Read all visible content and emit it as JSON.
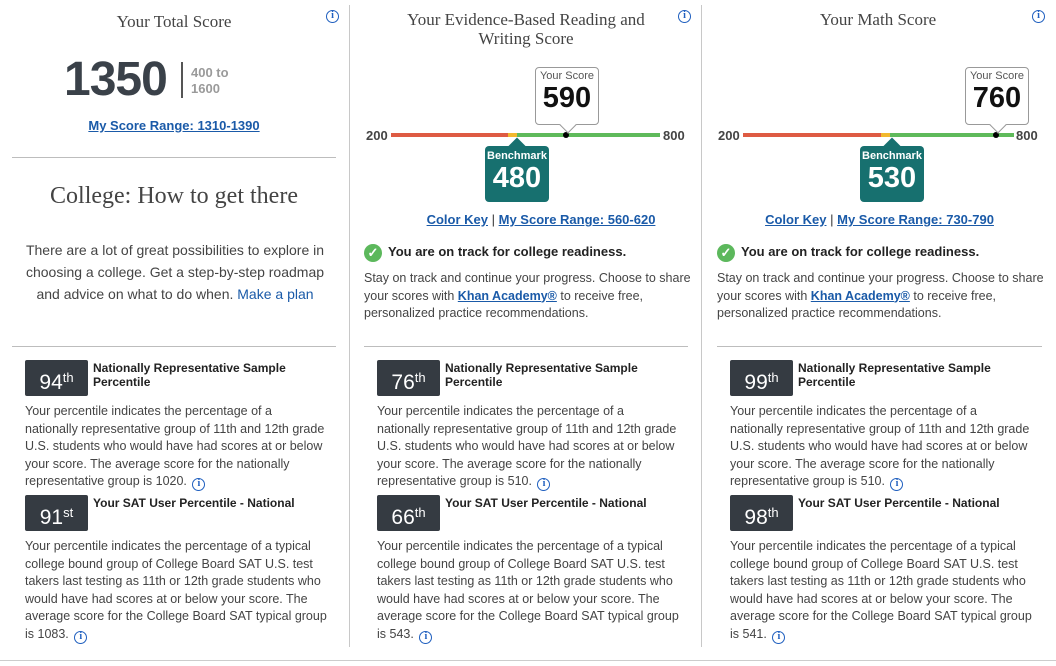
{
  "total": {
    "title": "Your Total Score",
    "score": "1350",
    "range_line1": "400 to",
    "range_line2": "1600",
    "score_range_link": "My Score Range: 1310-1390"
  },
  "college": {
    "title": "College: How to get there",
    "text": "There are a lot of great possibilities to explore in choosing a college. Get a step-by-step roadmap and advice on what to do when.",
    "link": "Make a plan"
  },
  "sections": [
    {
      "title": "Your Evidence-Based Reading and Writing Score",
      "min": "200",
      "max": "800",
      "your_score_label": "Your Score",
      "score": "590",
      "benchmark_label": "Benchmark",
      "benchmark": "480",
      "color_key": "Color Key",
      "separator": "|",
      "score_range_link": "My Score Range: 560-620",
      "on_track": "You are on track for college readiness.",
      "advice_before": "Stay on track and continue your progress. Choose to share your scores with",
      "advice_link": "Khan Academy®",
      "advice_after": "to receive free, personalized practice recommendations."
    },
    {
      "title": "Your Math Score",
      "min": "200",
      "max": "800",
      "your_score_label": "Your Score",
      "score": "760",
      "benchmark_label": "Benchmark",
      "benchmark": "530",
      "color_key": "Color Key",
      "separator": "|",
      "score_range_link": "My Score Range: 730-790",
      "on_track": "You are on track for college readiness.",
      "advice_before": "Stay on track and continue your progress. Choose to share your scores with",
      "advice_link": "Khan Academy®",
      "advice_after": "to receive free, personalized practice recommendations."
    }
  ],
  "percentiles": [
    {
      "nat_num": "94",
      "nat_suffix": "th",
      "nat_title": "Nationally Representative Sample Percentile",
      "nat_text": "Your percentile indicates the percentage of a nationally representative group of 11th and 12th grade U.S. students who would have had scores at or below your score. The average score for the nationally representative group is 1020.",
      "user_num": "91",
      "user_suffix": "st",
      "user_title": "Your SAT User Percentile - National",
      "user_text": "Your percentile indicates the percentage of a typical college bound group of College Board SAT U.S. test takers last testing as 11th or 12th grade students who would have had scores at or below your score. The average score for the College Board SAT typical group is 1083."
    },
    {
      "nat_num": "76",
      "nat_suffix": "th",
      "nat_title": "Nationally Representative Sample Percentile",
      "nat_text": "Your percentile indicates the percentage of a nationally representative group of 11th and 12th grade U.S. students who would have had scores at or below your score. The average score for the nationally representative group is 510.",
      "user_num": "66",
      "user_suffix": "th",
      "user_title": "Your SAT User Percentile - National",
      "user_text": "Your percentile indicates the percentage of a typical college bound group of College Board SAT U.S. test takers last testing as 11th or 12th grade students who would have had scores at or below your score. The average score for the College Board SAT typical group is 543."
    },
    {
      "nat_num": "99",
      "nat_suffix": "th",
      "nat_title": "Nationally Representative Sample Percentile",
      "nat_text": "Your percentile indicates the percentage of a nationally representative group of 11th and 12th grade U.S. students who would have had scores at or below your score. The average score for the nationally representative group is 510.",
      "user_num": "98",
      "user_suffix": "th",
      "user_title": "Your SAT User Percentile - National",
      "user_text": "Your percentile indicates the percentage of a typical college bound group of College Board SAT U.S. test takers last testing as 11th or 12th grade students who would have had scores at or below your score. The average score for the College Board SAT typical group is 541."
    }
  ],
  "icons": {
    "info": "info-icon",
    "check": "checkmark-icon"
  },
  "colors": {
    "accent": "#1a5aa8",
    "benchmark": "#17706f",
    "badge": "#353b42",
    "red": "#de5b43",
    "yellow": "#f2b82e",
    "green": "#5fba5b"
  }
}
